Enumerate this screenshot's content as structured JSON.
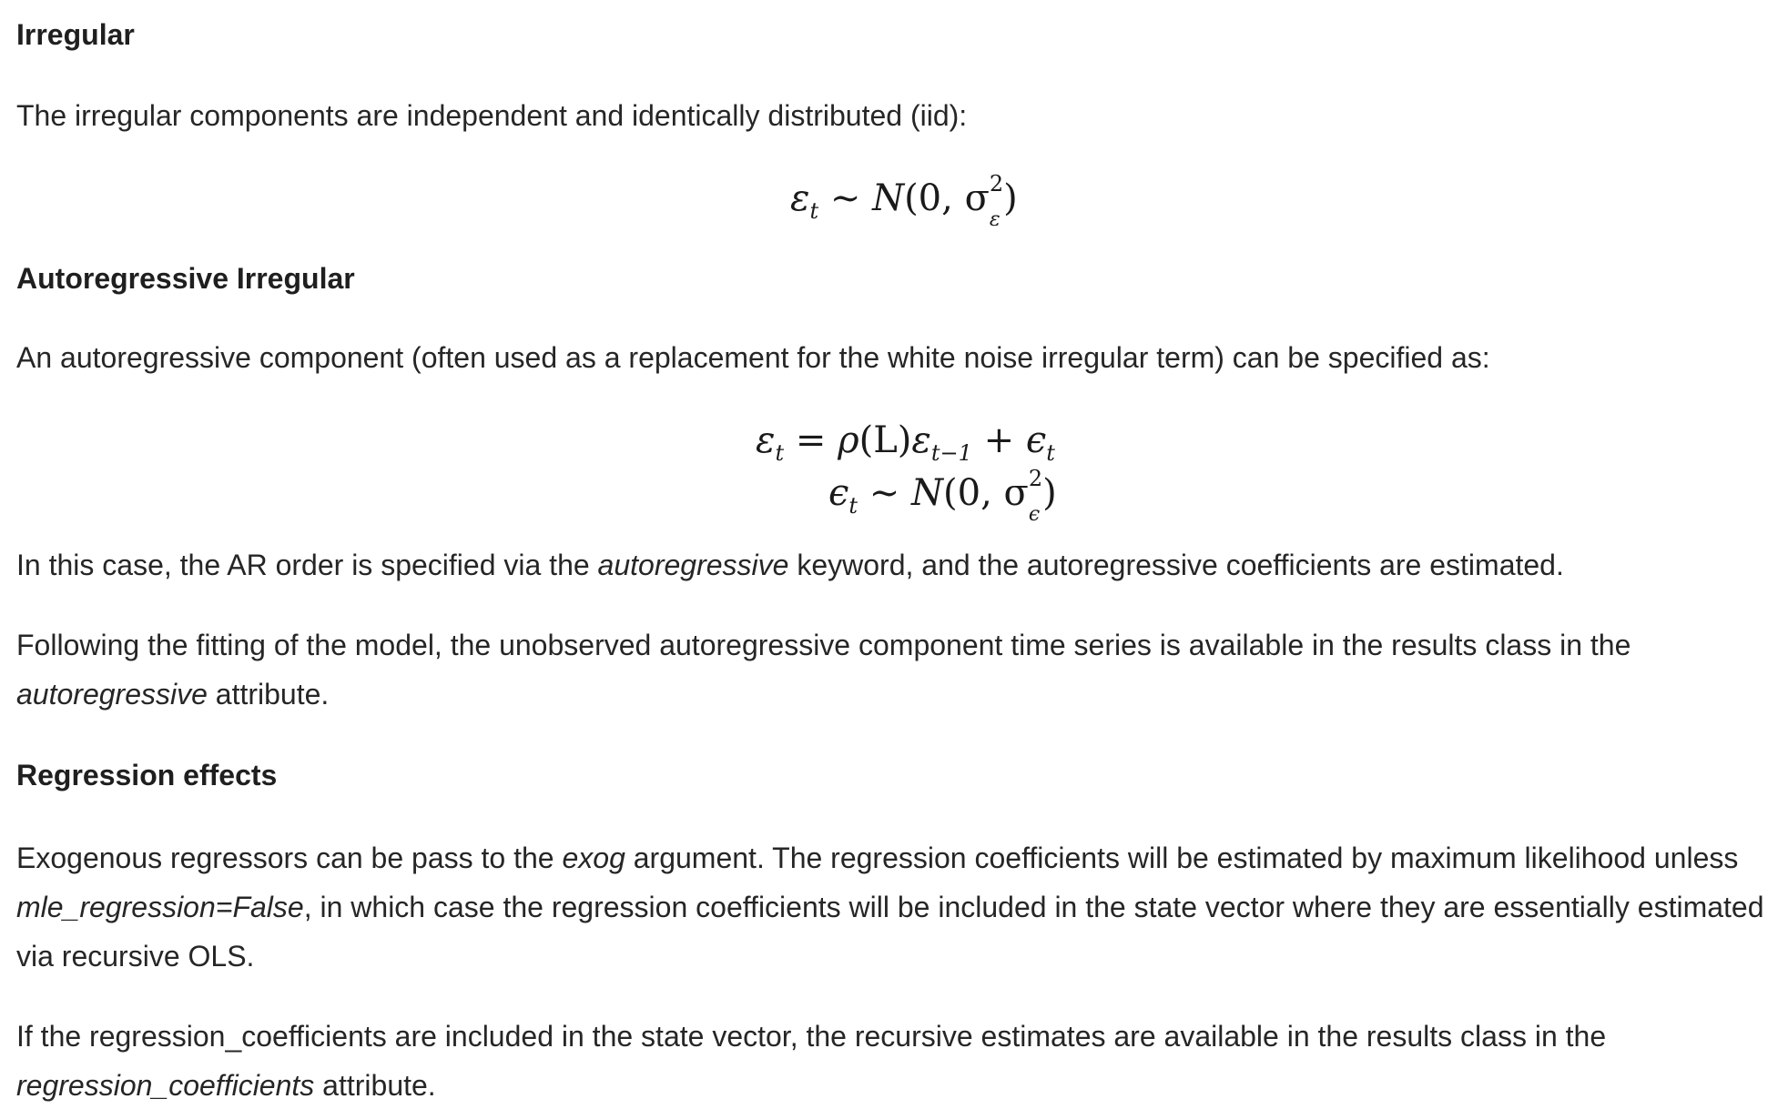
{
  "sections": {
    "irregular": {
      "heading": "Irregular",
      "text": "The irregular components are independent and identically distributed (iid):"
    },
    "autoregressive_irregular": {
      "heading": "Autoregressive Irregular",
      "text": "An autoregressive component (often used as a replacement for the white noise irregular term) can be specified as:",
      "p2_before": "In this case, the AR order is specified via the ",
      "p2_em": "autoregressive",
      "p2_after": " keyword, and the autoregressive coefficients are estimated.",
      "p3_before": "Following the fitting of the model, the unobserved autoregressive component time series is available in the results class in the ",
      "p3_em": "autoregressive",
      "p3_after": " attribute."
    },
    "regression_effects": {
      "heading": "Regression effects",
      "p1_before": "Exogenous regressors can be pass to the ",
      "p1_em1": "exog",
      "p1_mid": " argument. The regression coefficients will be estimated by maximum likelihood unless ",
      "p1_em2": "mle_regression=False",
      "p1_after": ", in which case the regression coefficients will be included in the state vector where they are essentially estimated via recursive OLS.",
      "p2_before": "If the regression_coefficients are included in the state vector, the recursive estimates are available in the results class in the ",
      "p2_em": "regression_coefficients",
      "p2_after": " attribute."
    }
  },
  "equations": {
    "eq1": {
      "lhs": "ε",
      "lhs_sub": "t",
      "rel": "∼",
      "rhs_fn": "N",
      "rhs_open": "(0, σ",
      "rhs_sup": "2",
      "rhs_sub": "ε",
      "rhs_close": ")"
    },
    "eq2a": {
      "lhs": "ε",
      "lhs_sub": "t",
      "rel": "=",
      "rho": "ρ",
      "paren_L": "(L)",
      "eps": "ε",
      "eps_sub": "t−1",
      "plus": "+",
      "eps2": "ϵ",
      "eps2_sub": "t"
    },
    "eq2b": {
      "lhs": "ϵ",
      "lhs_sub": "t",
      "rel": "∼",
      "rhs_fn": "N",
      "rhs_open": "(0, σ",
      "rhs_sup": "2",
      "rhs_sub": "ϵ",
      "rhs_close": ")"
    }
  }
}
